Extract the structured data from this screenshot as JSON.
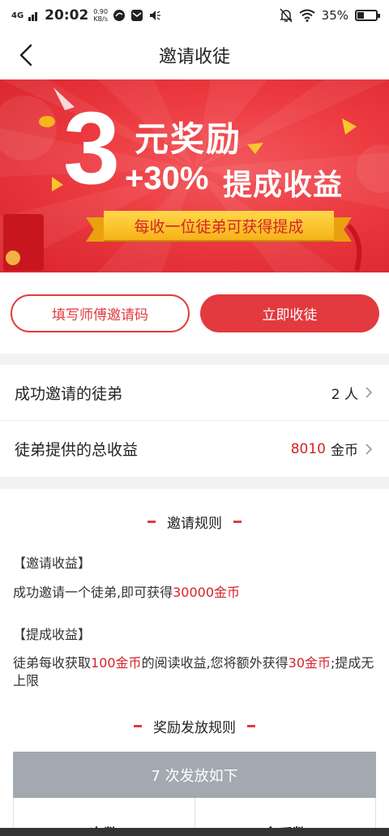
{
  "status_bar": {
    "network": "4G",
    "time": "20:02",
    "speed_value": "0.90",
    "speed_unit": "KB/s",
    "battery": "35%",
    "battery_level": 0.35
  },
  "nav": {
    "title": "邀请收徒"
  },
  "banner": {
    "number": "3",
    "reward_text": "元奖励",
    "bonus_percent": "+30%",
    "bonus_text": "提成收益",
    "ribbon_text": "每收一位徒弟可获得提成"
  },
  "buttons": {
    "fill_code": "填写师傅邀请码",
    "invite_now": "立即收徒"
  },
  "stats": {
    "invited_label": "成功邀请的徒弟",
    "invited_value": "2 人",
    "earnings_label": "徒弟提供的总收益",
    "earnings_value": "8010",
    "earnings_unit": "金币"
  },
  "rules": {
    "title": "邀请规则",
    "invite_heading": "【邀请收益】",
    "invite_text_prefix": "成功邀请一个徒弟,即可获得",
    "invite_text_amount": "30000金币",
    "commission_heading": "【提成收益】",
    "commission_text_1": "徒弟每收获取",
    "commission_text_amount_1": "100金币",
    "commission_text_2": "的阅读收益,您将额外获得",
    "commission_text_amount_2": "30金币",
    "commission_text_3": ";提成无上限",
    "payout_title": "奖励发放规则",
    "table_header": "7 次发放如下",
    "col_times": "次数",
    "col_coins": "金币数"
  },
  "colors": {
    "accent": "#e23a3f",
    "accent_text": "#d4232a",
    "banner_bg": "#ec3b41",
    "ribbon": "#f6b418",
    "table_header_bg": "#a2a9b0"
  }
}
